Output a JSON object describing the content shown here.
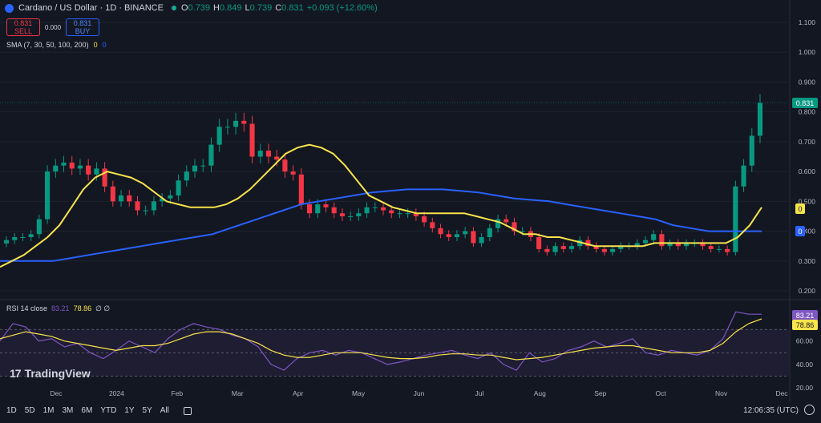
{
  "header": {
    "symbol": "Cardano / US Dollar · 1D · BINANCE",
    "ohlc": [
      {
        "k": "O",
        "v": "0.739"
      },
      {
        "k": "H",
        "v": "0.849"
      },
      {
        "k": "L",
        "v": "0.739"
      },
      {
        "k": "C",
        "v": "0.831"
      },
      {
        "k": "",
        "v": "+0.093 (+12.60%)"
      }
    ]
  },
  "trade": {
    "sell_price": "0.831",
    "sell_label": "SELL",
    "spread": "0.000",
    "buy_price": "0.831",
    "buy_label": "BUY"
  },
  "indicators": {
    "sma_label": "SMA (7, 30, 50, 100, 200)",
    "sma_v1": "0",
    "sma_v2": "0",
    "rsi_label": "RSI 14 close",
    "rsi_v1": "83.21",
    "rsi_v2": "78.86",
    "rsi_extra": "∅ ∅"
  },
  "price_axis": {
    "ticks": [
      "1.100",
      "1.000",
      "0.900",
      "0.800",
      "0.700",
      "0.600",
      "0.500",
      "0.400",
      "0.300",
      "0.200"
    ],
    "current_price": "0.831",
    "sma_a_tag": "0",
    "sma_b_tag": "0"
  },
  "rsi_axis": {
    "ticks": [
      "60.00",
      "40.00",
      "20.00"
    ],
    "rsi_tag": "83.21",
    "rsi_ma_tag": "78.86"
  },
  "time_axis": {
    "labels": [
      "Dec",
      "2024",
      "Feb",
      "Mar",
      "Apr",
      "May",
      "Jun",
      "Jul",
      "Aug",
      "Sep",
      "Oct",
      "Nov",
      "Dec"
    ]
  },
  "timeframes": [
    "1D",
    "5D",
    "1M",
    "3M",
    "6M",
    "YTD",
    "1Y",
    "5Y",
    "All"
  ],
  "clock": "12:06:35 (UTC)",
  "brand": "TradingView",
  "colors": {
    "up": "#089981",
    "down": "#f23645",
    "sma_short": "#f7e34b",
    "sma_long": "#2962ff",
    "rsi": "#7e57c2",
    "background": "#131722"
  },
  "chart_data": {
    "type": "candlestick",
    "title": "Cardano / US Dollar · 1D · BINANCE",
    "x": [
      "2023-11-18",
      "2023-11-22",
      "2023-11-26",
      "2023-11-30",
      "2023-12-04",
      "2023-12-08",
      "2023-12-12",
      "2023-12-16",
      "2023-12-20",
      "2023-12-24",
      "2023-12-28",
      "2024-01-01",
      "2024-01-05",
      "2024-01-09",
      "2024-01-13",
      "2024-01-17",
      "2024-01-21",
      "2024-01-25",
      "2024-01-29",
      "2024-02-02",
      "2024-02-06",
      "2024-02-10",
      "2024-02-14",
      "2024-02-18",
      "2024-02-22",
      "2024-02-26",
      "2024-03-01",
      "2024-03-05",
      "2024-03-09",
      "2024-03-13",
      "2024-03-17",
      "2024-03-21",
      "2024-03-25",
      "2024-03-29",
      "2024-04-02",
      "2024-04-06",
      "2024-04-10",
      "2024-04-14",
      "2024-04-18",
      "2024-04-22",
      "2024-04-26",
      "2024-04-30",
      "2024-05-04",
      "2024-05-08",
      "2024-05-12",
      "2024-05-16",
      "2024-05-20",
      "2024-05-24",
      "2024-05-28",
      "2024-06-01",
      "2024-06-05",
      "2024-06-09",
      "2024-06-13",
      "2024-06-17",
      "2024-06-21",
      "2024-06-25",
      "2024-06-29",
      "2024-07-03",
      "2024-07-07",
      "2024-07-11",
      "2024-07-15",
      "2024-07-19",
      "2024-07-23",
      "2024-07-27",
      "2024-07-31",
      "2024-08-04",
      "2024-08-08",
      "2024-08-12",
      "2024-08-16",
      "2024-08-20",
      "2024-08-24",
      "2024-08-28",
      "2024-09-01",
      "2024-09-05",
      "2024-09-09",
      "2024-09-13",
      "2024-09-17",
      "2024-09-21",
      "2024-09-25",
      "2024-09-29",
      "2024-10-03",
      "2024-10-07",
      "2024-10-11",
      "2024-10-15",
      "2024-10-19",
      "2024-10-23",
      "2024-10-27",
      "2024-10-31",
      "2024-11-04",
      "2024-11-08",
      "2024-11-12",
      "2024-11-16",
      "2024-11-20"
    ],
    "close": [
      0.37,
      0.38,
      0.38,
      0.39,
      0.44,
      0.6,
      0.62,
      0.63,
      0.61,
      0.62,
      0.59,
      0.61,
      0.55,
      0.5,
      0.52,
      0.5,
      0.47,
      0.47,
      0.5,
      0.51,
      0.52,
      0.57,
      0.6,
      0.62,
      0.62,
      0.69,
      0.75,
      0.75,
      0.77,
      0.76,
      0.65,
      0.67,
      0.65,
      0.64,
      0.6,
      0.59,
      0.49,
      0.46,
      0.49,
      0.48,
      0.46,
      0.45,
      0.45,
      0.46,
      0.48,
      0.48,
      0.47,
      0.46,
      0.46,
      0.46,
      0.45,
      0.43,
      0.41,
      0.39,
      0.38,
      0.39,
      0.4,
      0.36,
      0.38,
      0.41,
      0.44,
      0.43,
      0.4,
      0.4,
      0.38,
      0.34,
      0.33,
      0.35,
      0.34,
      0.35,
      0.37,
      0.35,
      0.34,
      0.33,
      0.34,
      0.35,
      0.35,
      0.36,
      0.37,
      0.39,
      0.35,
      0.36,
      0.35,
      0.36,
      0.36,
      0.35,
      0.34,
      0.34,
      0.33,
      0.55,
      0.62,
      0.72,
      0.83
    ],
    "sma_short": [
      0.28,
      0.3,
      0.32,
      0.35,
      0.38,
      0.42,
      0.48,
      0.54,
      0.58,
      0.6,
      0.59,
      0.58,
      0.56,
      0.53,
      0.5,
      0.49,
      0.48,
      0.48,
      0.48,
      0.49,
      0.51,
      0.54,
      0.58,
      0.62,
      0.66,
      0.68,
      0.69,
      0.68,
      0.66,
      0.62,
      0.57,
      0.52,
      0.5,
      0.48,
      0.47,
      0.46,
      0.46,
      0.46,
      0.46,
      0.46,
      0.45,
      0.44,
      0.43,
      0.41,
      0.39,
      0.39,
      0.38,
      0.38,
      0.37,
      0.36,
      0.35,
      0.35,
      0.35,
      0.35,
      0.35,
      0.36,
      0.36,
      0.36,
      0.36,
      0.36,
      0.36,
      0.36,
      0.38,
      0.42,
      0.48
    ],
    "sma_long": [
      0.3,
      0.3,
      0.3,
      0.3,
      0.31,
      0.32,
      0.33,
      0.34,
      0.35,
      0.36,
      0.37,
      0.38,
      0.39,
      0.41,
      0.43,
      0.45,
      0.47,
      0.49,
      0.5,
      0.51,
      0.52,
      0.53,
      0.535,
      0.54,
      0.54,
      0.54,
      0.535,
      0.53,
      0.52,
      0.51,
      0.505,
      0.5,
      0.49,
      0.48,
      0.47,
      0.46,
      0.45,
      0.44,
      0.42,
      0.41,
      0.4,
      0.4,
      0.4,
      0.4
    ],
    "rsi": [
      60,
      75,
      72,
      60,
      62,
      55,
      58,
      50,
      45,
      52,
      60,
      55,
      50,
      62,
      70,
      75,
      72,
      70,
      65,
      62,
      55,
      40,
      35,
      45,
      50,
      52,
      48,
      52,
      50,
      45,
      40,
      42,
      45,
      48,
      50,
      52,
      48,
      45,
      50,
      40,
      35,
      50,
      42,
      45,
      52,
      55,
      60,
      55,
      58,
      62,
      50,
      48,
      52,
      50,
      48,
      52,
      62,
      85,
      83,
      83
    ],
    "rsi_ma": [
      62,
      65,
      68,
      66,
      64,
      60,
      58,
      56,
      54,
      52,
      54,
      56,
      56,
      58,
      62,
      66,
      68,
      68,
      66,
      62,
      58,
      52,
      48,
      46,
      46,
      48,
      50,
      50,
      50,
      48,
      46,
      45,
      45,
      46,
      48,
      49,
      49,
      48,
      48,
      46,
      44,
      45,
      46,
      48,
      50,
      52,
      54,
      55,
      56,
      56,
      54,
      52,
      50,
      50,
      50,
      52,
      58,
      68,
      75,
      79
    ],
    "price_range": [
      0.2,
      1.1
    ],
    "rsi_range": [
      20,
      90
    ]
  }
}
